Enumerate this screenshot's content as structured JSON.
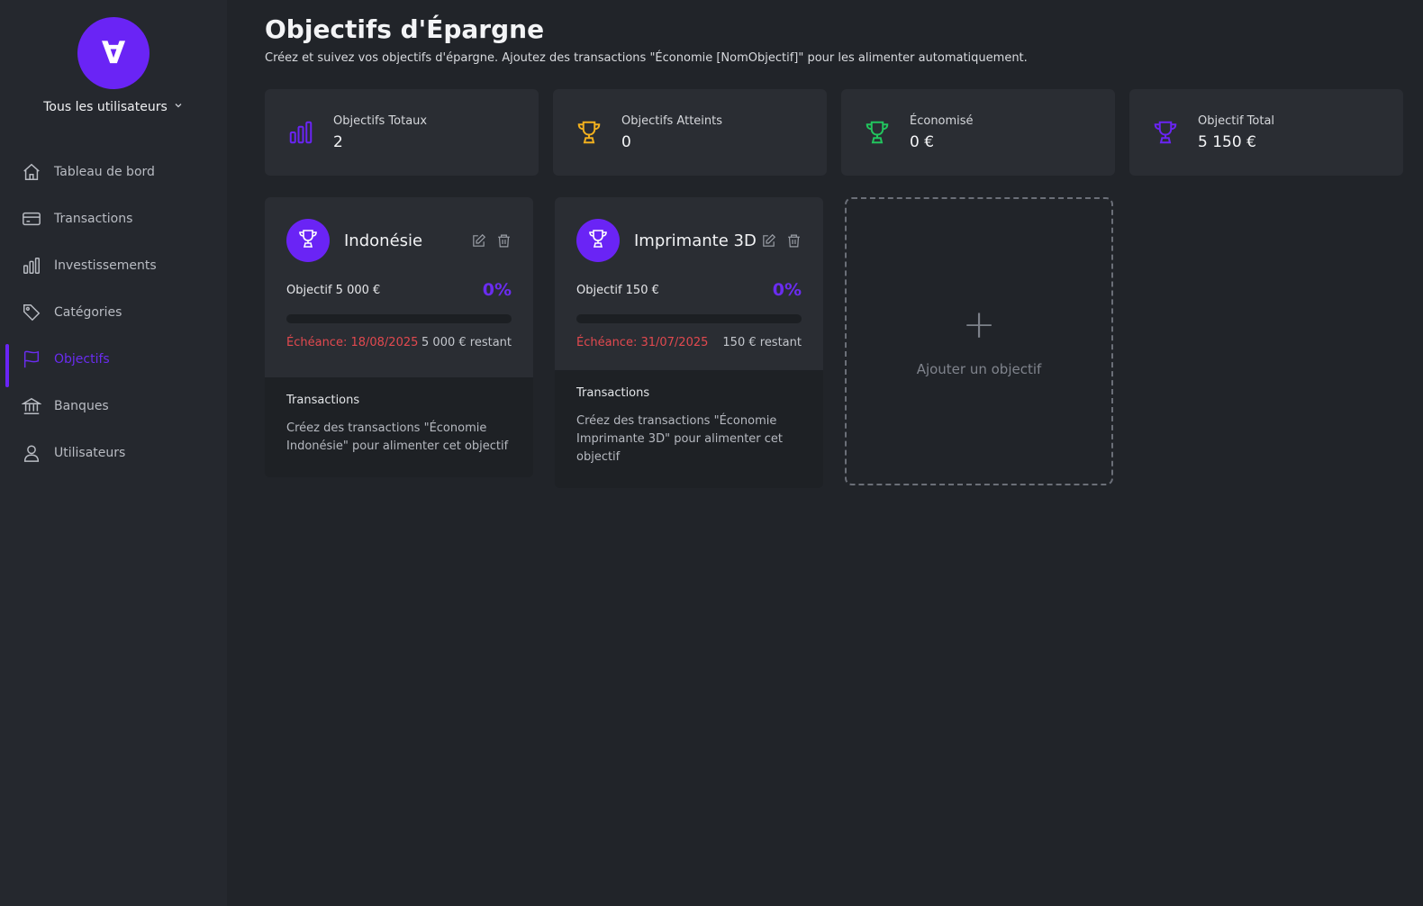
{
  "sidebar": {
    "logo_glyph": "∀",
    "user_select": "Tous les utilisateurs",
    "items": [
      {
        "label": "Tableau de bord",
        "icon": "home-icon"
      },
      {
        "label": "Transactions",
        "icon": "card-icon"
      },
      {
        "label": "Investissements",
        "icon": "bar-chart-icon"
      },
      {
        "label": "Catégories",
        "icon": "tag-icon"
      },
      {
        "label": "Objectifs",
        "icon": "flag-icon",
        "active": true
      },
      {
        "label": "Banques",
        "icon": "bank-icon"
      },
      {
        "label": "Utilisateurs",
        "icon": "user-icon"
      }
    ]
  },
  "header": {
    "title": "Objectifs d'Épargne",
    "subtitle": "Créez et suivez vos objectifs d'épargne. Ajoutez des transactions \"Économie [NomObjectif]\" pour les alimenter automatiquement."
  },
  "stats": [
    {
      "label": "Objectifs Totaux",
      "value": "2",
      "icon": "bar-chart-icon",
      "color": "#6a24f5"
    },
    {
      "label": "Objectifs Atteints",
      "value": "0",
      "icon": "trophy-icon",
      "color": "#f2b01e"
    },
    {
      "label": "Économisé",
      "value": "0 €",
      "icon": "trophy-icon",
      "color": "#22c55e"
    },
    {
      "label": "Objectif Total",
      "value": "5 150 €",
      "icon": "trophy-icon",
      "color": "#6a24f5"
    }
  ],
  "goals": [
    {
      "name": "Indonésie",
      "target": "Objectif 5 000 €",
      "percent": "0%",
      "progress": 0,
      "deadline": "Échéance: 18/08/2025",
      "remaining": "5 000 € restant",
      "tx_title": "Transactions",
      "tx_desc": "Créez des transactions \"Économie Indonésie\" pour alimenter cet objectif"
    },
    {
      "name": "Imprimante 3D",
      "target": "Objectif 150 €",
      "percent": "0%",
      "progress": 0,
      "deadline": "Échéance: 31/07/2025",
      "remaining": "150 € restant",
      "tx_title": "Transactions",
      "tx_desc": "Créez des transactions \"Économie Imprimante 3D\" pour alimenter cet objectif"
    }
  ],
  "add_goal": {
    "plus": "+",
    "label": "Ajouter un objectif"
  },
  "colors": {
    "accent": "#6a24f5",
    "danger": "#e2494f",
    "gold": "#f2b01e",
    "green": "#22c55e"
  }
}
